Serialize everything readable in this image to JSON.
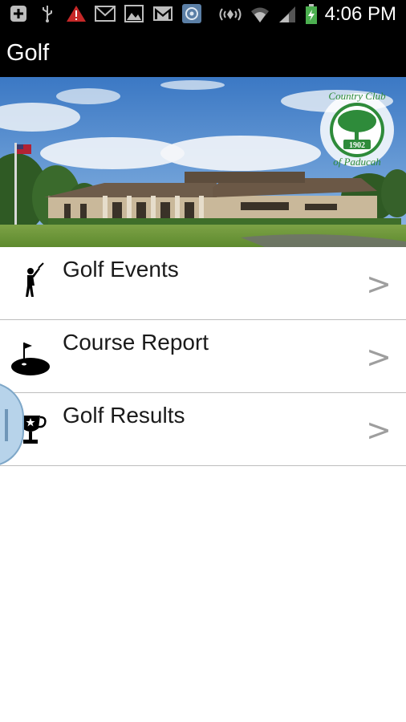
{
  "status_bar": {
    "time": "4:06 PM",
    "left_icons": [
      "plus-box-icon",
      "usb-icon",
      "warning-icon",
      "mail-icon",
      "image-icon",
      "gmail-icon",
      "app-icon"
    ],
    "right_icons": [
      "nfc-icon",
      "wifi-icon",
      "signal-icon",
      "battery-icon"
    ]
  },
  "header": {
    "title": "Golf"
  },
  "hero": {
    "logo_top_text": "Country Club",
    "logo_year": "1902",
    "logo_bottom_text": "of Paducah"
  },
  "menu": {
    "items": [
      {
        "label": "Golf Events",
        "icon": "golfer-icon",
        "chevron": ">"
      },
      {
        "label": "Course Report",
        "icon": "green-flag-icon",
        "chevron": ">"
      },
      {
        "label": "Golf Results",
        "icon": "trophy-icon",
        "chevron": ">"
      }
    ]
  },
  "colors": {
    "status_bar_bg": "#000000",
    "title_bar_bg": "#000000",
    "logo_green": "#2e8b3a",
    "divider": "#bdbdbd",
    "chevron": "#9e9e9e"
  }
}
